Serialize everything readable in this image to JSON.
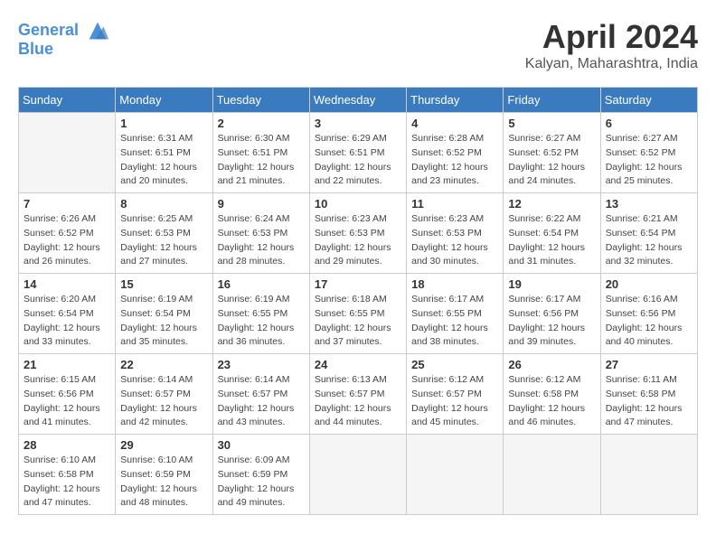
{
  "header": {
    "logo_line1": "General",
    "logo_line2": "Blue",
    "month": "April 2024",
    "location": "Kalyan, Maharashtra, India"
  },
  "weekdays": [
    "Sunday",
    "Monday",
    "Tuesday",
    "Wednesday",
    "Thursday",
    "Friday",
    "Saturday"
  ],
  "weeks": [
    [
      {
        "day": "",
        "empty": true
      },
      {
        "day": "1",
        "sunrise": "6:31 AM",
        "sunset": "6:51 PM",
        "daylight": "12 hours and 20 minutes."
      },
      {
        "day": "2",
        "sunrise": "6:30 AM",
        "sunset": "6:51 PM",
        "daylight": "12 hours and 21 minutes."
      },
      {
        "day": "3",
        "sunrise": "6:29 AM",
        "sunset": "6:51 PM",
        "daylight": "12 hours and 22 minutes."
      },
      {
        "day": "4",
        "sunrise": "6:28 AM",
        "sunset": "6:52 PM",
        "daylight": "12 hours and 23 minutes."
      },
      {
        "day": "5",
        "sunrise": "6:27 AM",
        "sunset": "6:52 PM",
        "daylight": "12 hours and 24 minutes."
      },
      {
        "day": "6",
        "sunrise": "6:27 AM",
        "sunset": "6:52 PM",
        "daylight": "12 hours and 25 minutes."
      }
    ],
    [
      {
        "day": "7",
        "sunrise": "6:26 AM",
        "sunset": "6:52 PM",
        "daylight": "12 hours and 26 minutes."
      },
      {
        "day": "8",
        "sunrise": "6:25 AM",
        "sunset": "6:53 PM",
        "daylight": "12 hours and 27 minutes."
      },
      {
        "day": "9",
        "sunrise": "6:24 AM",
        "sunset": "6:53 PM",
        "daylight": "12 hours and 28 minutes."
      },
      {
        "day": "10",
        "sunrise": "6:23 AM",
        "sunset": "6:53 PM",
        "daylight": "12 hours and 29 minutes."
      },
      {
        "day": "11",
        "sunrise": "6:23 AM",
        "sunset": "6:53 PM",
        "daylight": "12 hours and 30 minutes."
      },
      {
        "day": "12",
        "sunrise": "6:22 AM",
        "sunset": "6:54 PM",
        "daylight": "12 hours and 31 minutes."
      },
      {
        "day": "13",
        "sunrise": "6:21 AM",
        "sunset": "6:54 PM",
        "daylight": "12 hours and 32 minutes."
      }
    ],
    [
      {
        "day": "14",
        "sunrise": "6:20 AM",
        "sunset": "6:54 PM",
        "daylight": "12 hours and 33 minutes."
      },
      {
        "day": "15",
        "sunrise": "6:19 AM",
        "sunset": "6:54 PM",
        "daylight": "12 hours and 35 minutes."
      },
      {
        "day": "16",
        "sunrise": "6:19 AM",
        "sunset": "6:55 PM",
        "daylight": "12 hours and 36 minutes."
      },
      {
        "day": "17",
        "sunrise": "6:18 AM",
        "sunset": "6:55 PM",
        "daylight": "12 hours and 37 minutes."
      },
      {
        "day": "18",
        "sunrise": "6:17 AM",
        "sunset": "6:55 PM",
        "daylight": "12 hours and 38 minutes."
      },
      {
        "day": "19",
        "sunrise": "6:17 AM",
        "sunset": "6:56 PM",
        "daylight": "12 hours and 39 minutes."
      },
      {
        "day": "20",
        "sunrise": "6:16 AM",
        "sunset": "6:56 PM",
        "daylight": "12 hours and 40 minutes."
      }
    ],
    [
      {
        "day": "21",
        "sunrise": "6:15 AM",
        "sunset": "6:56 PM",
        "daylight": "12 hours and 41 minutes."
      },
      {
        "day": "22",
        "sunrise": "6:14 AM",
        "sunset": "6:57 PM",
        "daylight": "12 hours and 42 minutes."
      },
      {
        "day": "23",
        "sunrise": "6:14 AM",
        "sunset": "6:57 PM",
        "daylight": "12 hours and 43 minutes."
      },
      {
        "day": "24",
        "sunrise": "6:13 AM",
        "sunset": "6:57 PM",
        "daylight": "12 hours and 44 minutes."
      },
      {
        "day": "25",
        "sunrise": "6:12 AM",
        "sunset": "6:57 PM",
        "daylight": "12 hours and 45 minutes."
      },
      {
        "day": "26",
        "sunrise": "6:12 AM",
        "sunset": "6:58 PM",
        "daylight": "12 hours and 46 minutes."
      },
      {
        "day": "27",
        "sunrise": "6:11 AM",
        "sunset": "6:58 PM",
        "daylight": "12 hours and 47 minutes."
      }
    ],
    [
      {
        "day": "28",
        "sunrise": "6:10 AM",
        "sunset": "6:58 PM",
        "daylight": "12 hours and 47 minutes."
      },
      {
        "day": "29",
        "sunrise": "6:10 AM",
        "sunset": "6:59 PM",
        "daylight": "12 hours and 48 minutes."
      },
      {
        "day": "30",
        "sunrise": "6:09 AM",
        "sunset": "6:59 PM",
        "daylight": "12 hours and 49 minutes."
      },
      {
        "day": "",
        "empty": true
      },
      {
        "day": "",
        "empty": true
      },
      {
        "day": "",
        "empty": true
      },
      {
        "day": "",
        "empty": true
      }
    ]
  ]
}
